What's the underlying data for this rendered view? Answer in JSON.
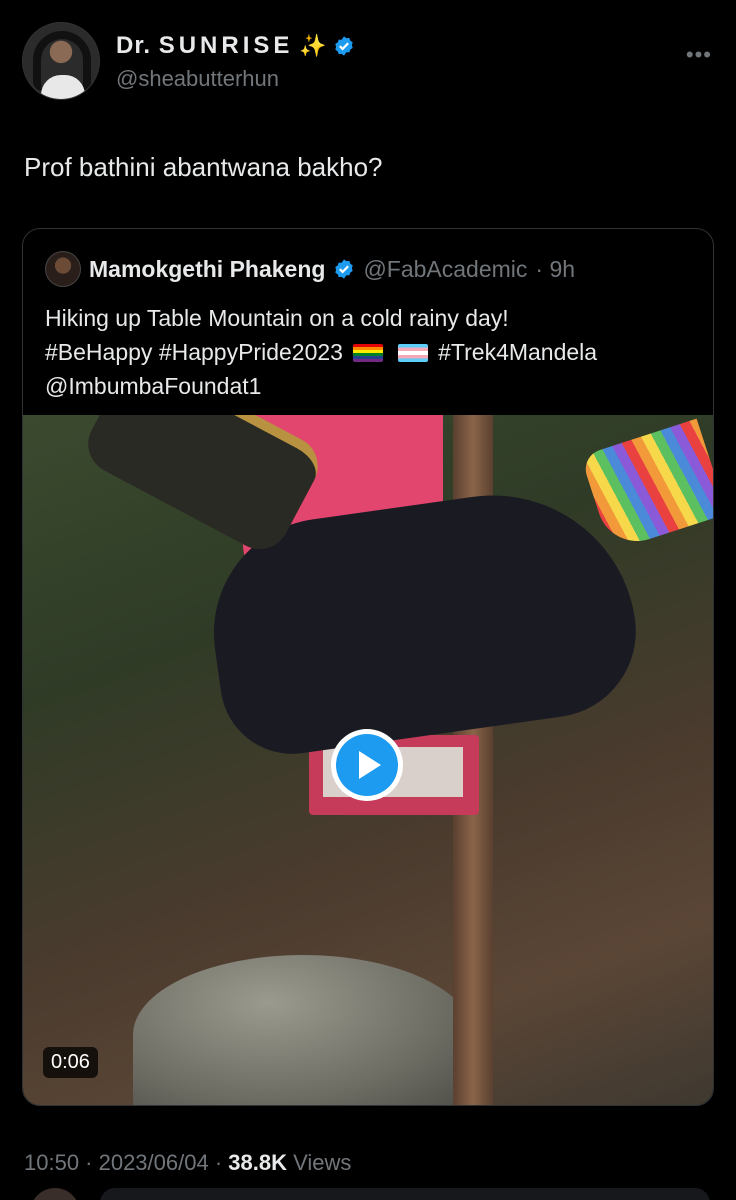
{
  "tweet": {
    "author": {
      "display_name": "Dr.",
      "display_name_spaced": "SUNRISE",
      "sparkle": "✨",
      "handle": "@sheabutterhun"
    },
    "more_icon": "more-horizontal-icon",
    "text": "Prof bathini abantwana bakho?",
    "timestamp": "10:50 · 2023/06/04 ·",
    "views_count": "38.8K",
    "views_label": "Views"
  },
  "quote": {
    "author": {
      "display_name": "Mamokgethi Phakeng",
      "handle": "@FabAcademic",
      "age": "· 9h"
    },
    "line1": "Hiking up Table Mountain on a cold rainy day!",
    "line2_tag1": "#BeHappy",
    "line2_tag2": "#HappyPride2023",
    "line2_tag3": "#Trek4Mandela",
    "line3": "@ImbumbaFoundat1",
    "video": {
      "duration": "0:06",
      "play_icon": "play-icon"
    }
  },
  "colors": {
    "background": "#000000",
    "verified": "#1d9bf0",
    "secondary_text": "#71767b",
    "primary_text": "#e7e9ea"
  }
}
